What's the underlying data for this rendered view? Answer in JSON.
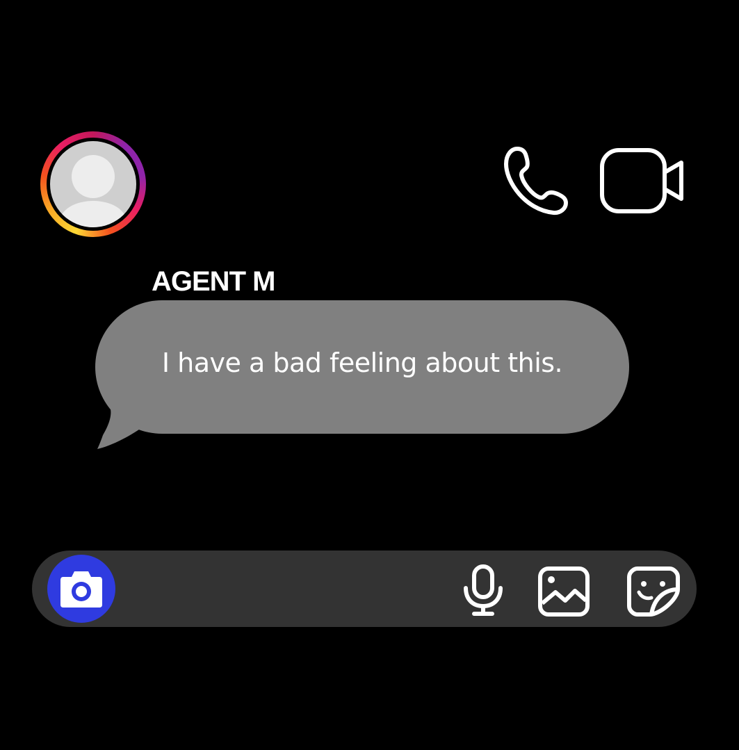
{
  "header": {
    "avatar_icon": "default-user-avatar-icon",
    "ring_colors": [
      "#fdd835",
      "#f4511e",
      "#e91e63",
      "#8e24aa"
    ],
    "call_icon": "phone-icon",
    "video_icon": "video-camera-icon"
  },
  "conversation": {
    "sender_name": "AGENT M",
    "messages": [
      {
        "text": "I have a bad feeling about this.",
        "bubble_color": "#808080"
      }
    ]
  },
  "composer": {
    "camera_icon": "camera-icon",
    "camera_button_color": "#2f3be0",
    "mic_icon": "microphone-icon",
    "gallery_icon": "image-gallery-icon",
    "sticker_icon": "sticker-icon",
    "bar_color": "#333333"
  }
}
